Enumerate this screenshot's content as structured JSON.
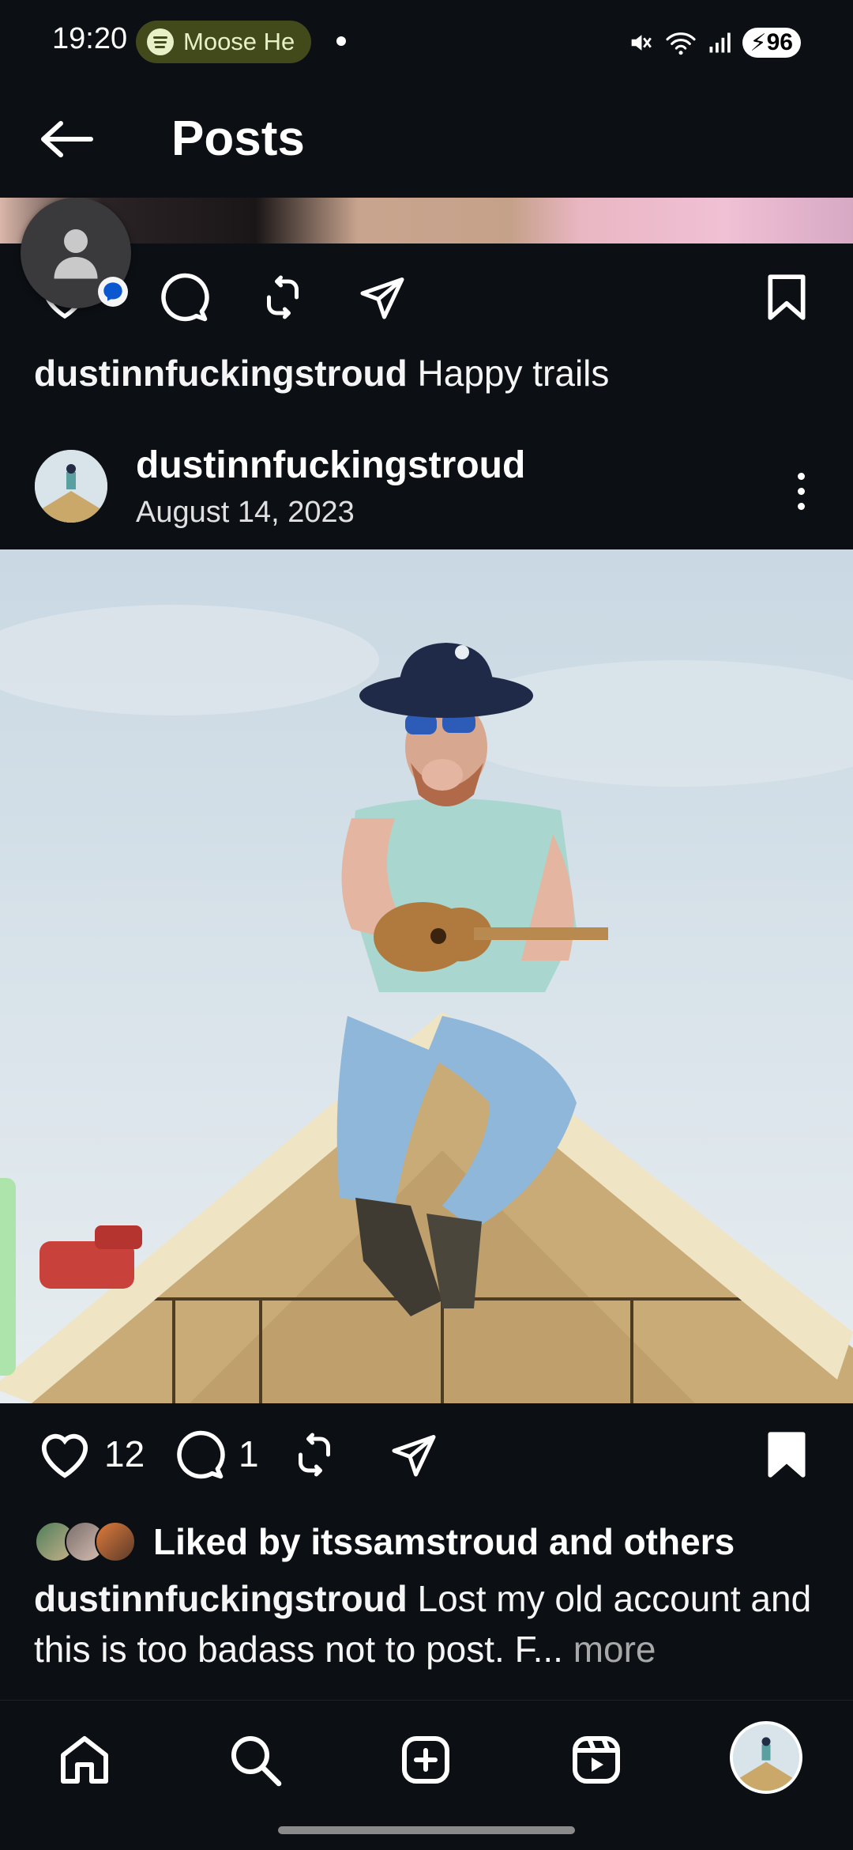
{
  "status_bar": {
    "time": "19:20",
    "media_app": "Moose He",
    "battery": "96",
    "icons": [
      "mute-icon",
      "wifi-icon",
      "signal-icon",
      "battery-icon"
    ]
  },
  "header": {
    "title": "Posts",
    "back_icon": "arrow-left-icon"
  },
  "previous_post": {
    "username": "dustinnfuckingstroud",
    "caption": "Happy trails",
    "bookmarked": false
  },
  "post": {
    "username": "dustinnfuckingstroud",
    "date": "August 14, 2023",
    "likes_count": "12",
    "comments_count": "1",
    "liked_by": "Liked by itssamstroud and others",
    "caption_username": "dustinnfuckingstroud",
    "caption_text": "Lost my old account and this is too badass not to post. F...",
    "caption_more": " more",
    "bookmarked": true
  },
  "bottom_nav": {
    "items": [
      "home-icon",
      "search-icon",
      "create-icon",
      "reels-icon",
      "profile-avatar"
    ]
  },
  "colors": {
    "background": "#0c1014",
    "text": "#f5f5f5",
    "secondary_text": "#a8a8a8",
    "spotify_pill": "#424a1c"
  }
}
